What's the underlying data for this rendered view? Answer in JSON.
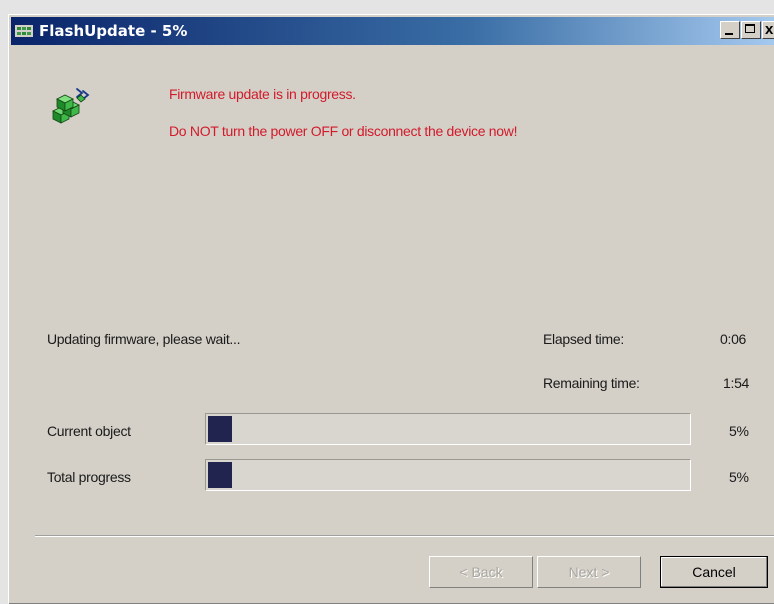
{
  "window": {
    "title": "FlashUpdate - 5%",
    "controls": {
      "minimize": "_",
      "maximize": "□",
      "close": "x"
    }
  },
  "warning": {
    "line1": "Firmware update is in progress.",
    "line2": "Do NOT turn the power OFF or disconnect the device now!"
  },
  "status": {
    "message": "Updating firmware, please wait...",
    "elapsed_label": "Elapsed time:",
    "elapsed_value": "0:06",
    "remaining_label": "Remaining time:",
    "remaining_value": "1:54"
  },
  "progress": {
    "current": {
      "label": "Current object",
      "percent_text": "5%",
      "fraction": 0.05
    },
    "total": {
      "label": "Total progress",
      "percent_text": "5%",
      "fraction": 0.05
    }
  },
  "buttons": {
    "back": "< Back",
    "next": "Next >",
    "cancel": "Cancel"
  },
  "colors": {
    "warning_text": "#d21a2a",
    "progress_fill": "#20244e",
    "titlebar_start": "#0a246a"
  },
  "icons": {
    "title": "app-grid-icon",
    "main": "firmware-cubes-icon"
  }
}
